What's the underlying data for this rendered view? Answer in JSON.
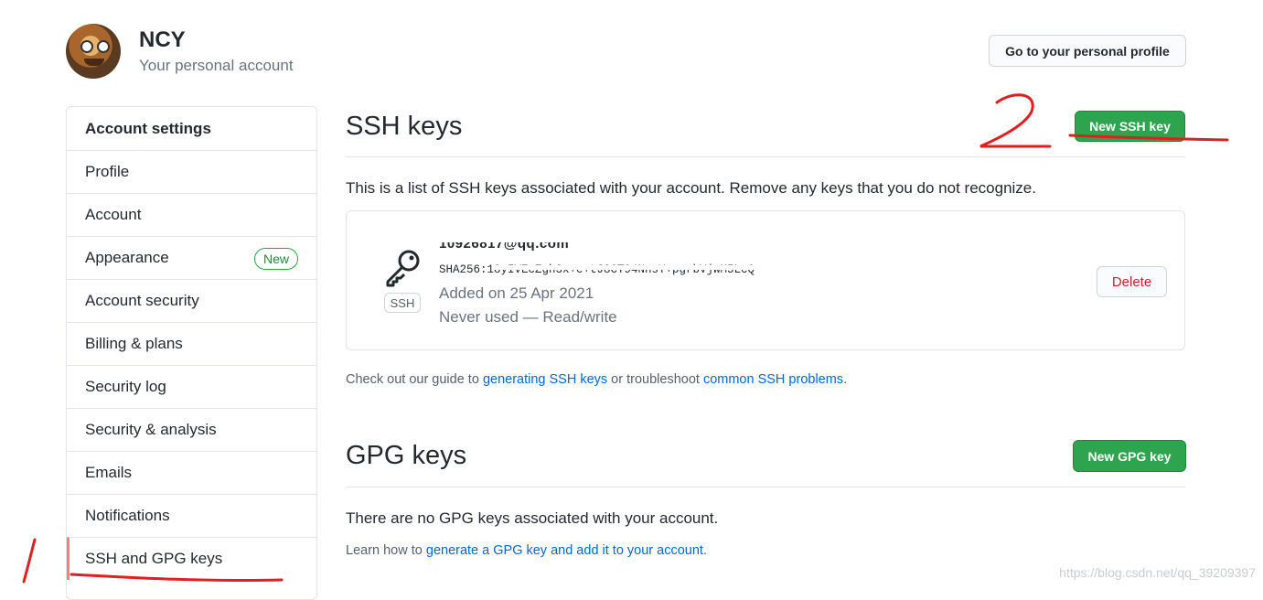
{
  "header": {
    "username": "NCY",
    "subtitle": "Your personal account",
    "profile_button": "Go to your personal profile"
  },
  "sidebar": {
    "heading": "Account settings",
    "items": [
      {
        "label": "Profile"
      },
      {
        "label": "Account"
      },
      {
        "label": "Appearance",
        "badge": "New"
      },
      {
        "label": "Account security"
      },
      {
        "label": "Billing & plans"
      },
      {
        "label": "Security log"
      },
      {
        "label": "Security & analysis"
      },
      {
        "label": "Emails"
      },
      {
        "label": "Notifications"
      },
      {
        "label": "SSH and GPG keys",
        "selected": true
      }
    ]
  },
  "ssh": {
    "title": "SSH keys",
    "new_button": "New SSH key",
    "description": "This is a list of SSH keys associated with your account. Remove any keys that you do not recognize.",
    "key": {
      "icon": "key-icon",
      "tag": "SSH",
      "title": "10926817@qq.com",
      "fingerprint": "SHA256:18yIVEcZgh3x+e+tJ8CT94NnsY+pgrbVjwM5LcQ",
      "added": "Added on 25 Apr 2021",
      "usage": "Never used — Read/write",
      "delete_button": "Delete"
    },
    "guide": {
      "prefix": "Check out our guide to ",
      "link1": "generating SSH keys",
      "middle": " or troubleshoot ",
      "link2": "common SSH problems",
      "suffix": "."
    }
  },
  "gpg": {
    "title": "GPG keys",
    "new_button": "New GPG key",
    "empty": "There are no GPG keys associated with your account.",
    "learn_prefix": "Learn how to ",
    "learn_link": "generate a GPG key and add it to your account",
    "learn_suffix": "."
  },
  "annotations": {
    "step1": "1",
    "step2": "2",
    "color": "#e0201f"
  },
  "watermark": "https://blog.csdn.net/qq_39209397"
}
